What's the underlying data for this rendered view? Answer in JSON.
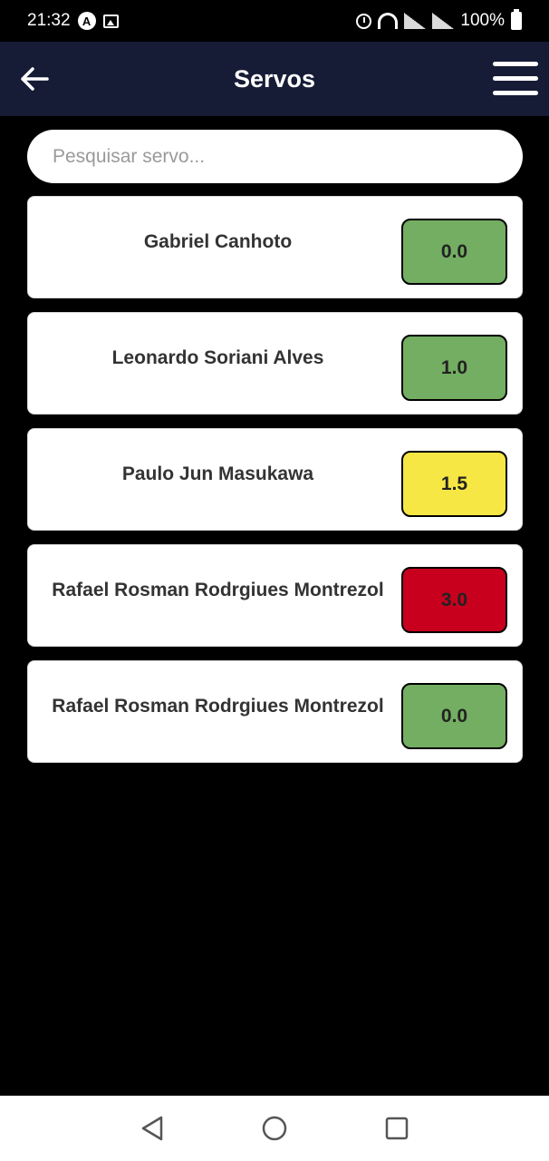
{
  "status_bar": {
    "time": "21:32",
    "battery": "100%",
    "icons": [
      "a-circle-icon",
      "image-icon",
      "alarm-icon",
      "wifi-icon",
      "signal-icon",
      "signal-icon",
      "battery-icon"
    ]
  },
  "header": {
    "title": "Servos",
    "background": "#161b36"
  },
  "search": {
    "placeholder": "Pesquisar servo...",
    "value": ""
  },
  "servos": [
    {
      "name": "Gabriel Canhoto",
      "score": "0.0",
      "color": "#73ae62"
    },
    {
      "name": "Leonardo Soriani Alves",
      "score": "1.0",
      "color": "#73ae62"
    },
    {
      "name": "Paulo Jun Masukawa",
      "score": "1.5",
      "color": "#f7e744"
    },
    {
      "name": "Rafael Rosman Rodrgiues Montrezol",
      "score": "3.0",
      "color": "#c8001e"
    },
    {
      "name": "Rafael Rosman Rodrgiues Montrezol",
      "score": "0.0",
      "color": "#73ae62"
    }
  ],
  "nav": {
    "icons": [
      "back-triangle-icon",
      "home-circle-icon",
      "recents-square-icon"
    ]
  }
}
